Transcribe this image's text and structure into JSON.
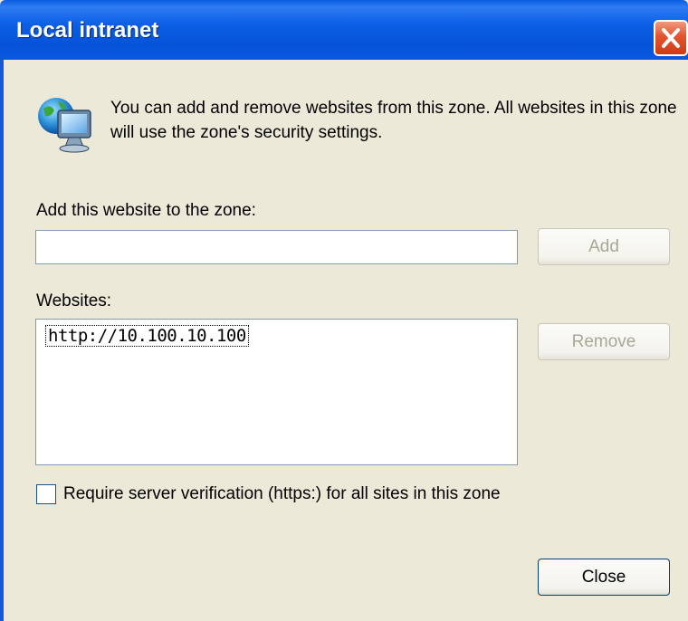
{
  "window": {
    "title": "Local intranet"
  },
  "info": {
    "text": "You can add and remove websites from this zone. All websites in this zone will use the zone's security settings."
  },
  "add_section": {
    "label": "Add this website to the zone:",
    "input_value": "",
    "add_button": "Add"
  },
  "websites_section": {
    "label": "Websites:",
    "items": [
      "http://10.100.10.100"
    ],
    "remove_button": "Remove"
  },
  "verification": {
    "label": "Require server verification (https:) for all sites in this zone",
    "checked": false
  },
  "footer": {
    "close_button": "Close"
  },
  "colors": {
    "titlebar": "#0a5be0",
    "dialog_bg": "#ece9d8",
    "close_red": "#e2552f"
  },
  "icons": {
    "zone_icon": "intranet-globe-monitor-icon",
    "close_icon": "close-x-icon"
  }
}
